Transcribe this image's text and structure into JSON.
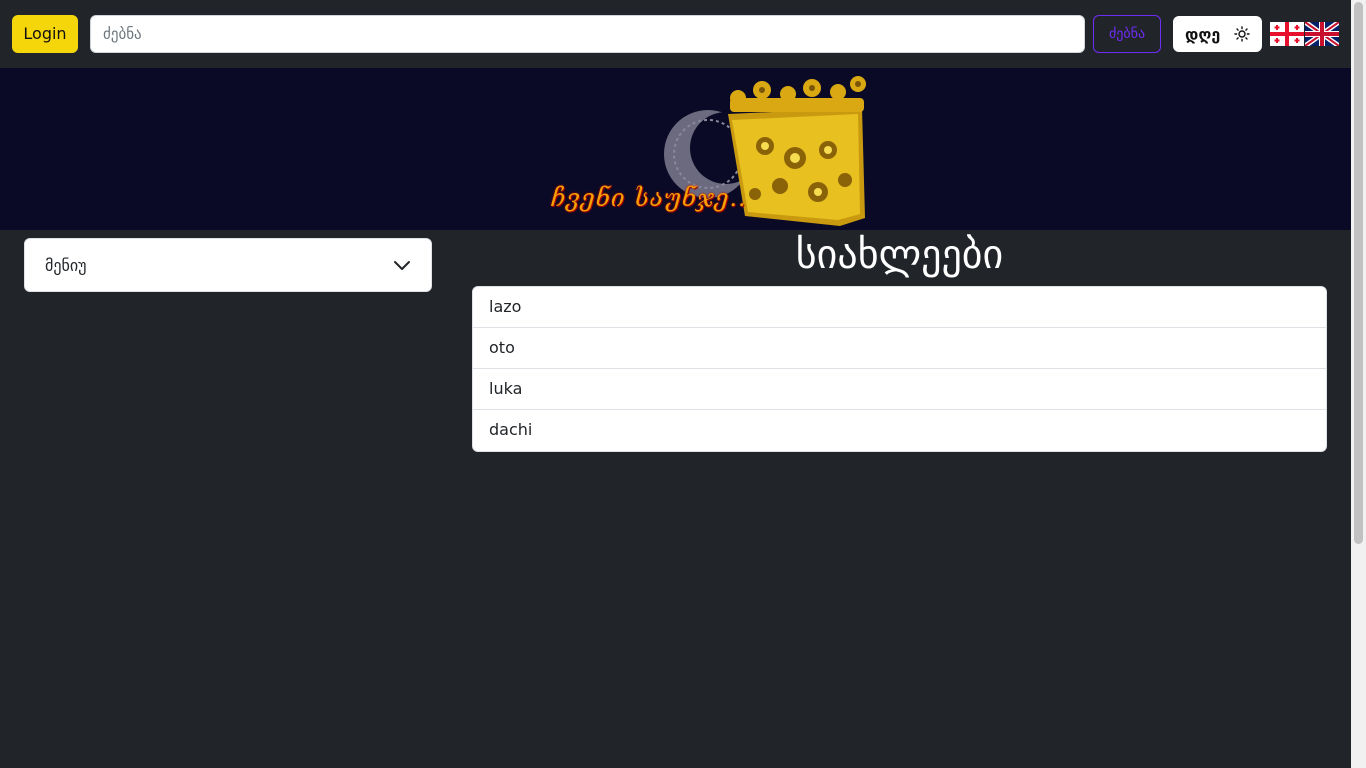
{
  "navbar": {
    "login_label": "Login",
    "search_placeholder": "ძებნა",
    "search_button_label": "ძებნა",
    "theme_label": "დღე",
    "theme_icon": "sun-icon",
    "flags": [
      "georgia-flag-icon",
      "uk-flag-icon"
    ],
    "accent_colors": {
      "login": "#f5d60a",
      "search_button": "#6f2cf5"
    }
  },
  "banner": {
    "text": "ჩვენი საუნჯე..",
    "background": "#0b0a26"
  },
  "sidebar": {
    "menu_label": "მენიუ",
    "menu_icon": "chevron-down-icon"
  },
  "news": {
    "title": "სიახლეები",
    "items": [
      {
        "label": "lazo"
      },
      {
        "label": "oto"
      },
      {
        "label": "luka"
      },
      {
        "label": "dachi"
      }
    ]
  }
}
